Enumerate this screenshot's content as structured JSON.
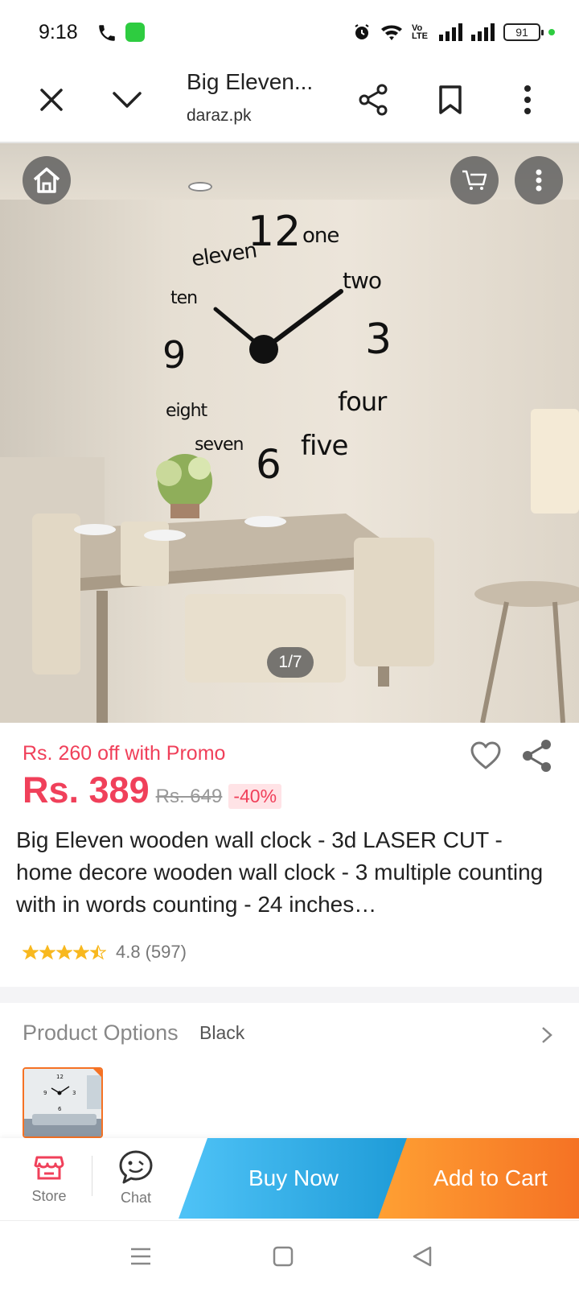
{
  "status_bar": {
    "time": "9:18",
    "volte": "Vo LTE",
    "battery": "91"
  },
  "browser": {
    "page_title": "Big Eleven...",
    "domain": "daraz.pk"
  },
  "gallery": {
    "counter": "1/7",
    "clock_words": [
      "12",
      "one",
      "eleven",
      "two",
      "ten",
      "9",
      "3",
      "eight",
      "four",
      "seven",
      "6",
      "five"
    ]
  },
  "product": {
    "promo_text": "Rs. 260 off with Promo",
    "price": "Rs. 389",
    "original_price": "Rs. 649",
    "discount": "-40%",
    "title": "Big Eleven wooden wall clock - 3d LASER CUT - home decore wooden wall clock - 3 multiple counting with in words counting - 24 inches…",
    "rating": "4.8",
    "rating_count": "(597)",
    "stars_filled": 4.5
  },
  "options": {
    "label": "Product Options",
    "value": "Black"
  },
  "action_bar": {
    "store_label": "Store",
    "chat_label": "Chat",
    "buy_now_label": "Buy Now",
    "add_to_cart_label": "Add to Cart"
  },
  "colors": {
    "accent_red": "#f0405a",
    "orange": "#f57224",
    "blue": "#1e9bd7"
  }
}
